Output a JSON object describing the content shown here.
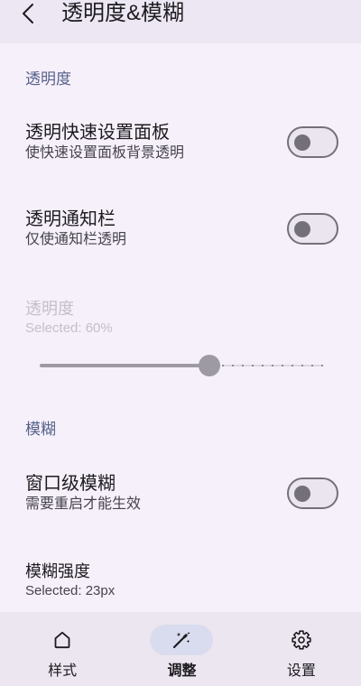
{
  "app_bar": {
    "back_icon": "chevron-left-icon",
    "title": "透明度&模糊"
  },
  "transparency_section": {
    "header": "透明度",
    "qs_panel": {
      "title": "透明快速设置面板",
      "summary": "使快速设置面板背景透明",
      "enabled": false
    },
    "notification_bar": {
      "title": "透明通知栏",
      "summary": "仅使通知栏透明",
      "enabled": false
    },
    "opacity": {
      "title": "透明度",
      "summary": "Selected: 60%",
      "value_percent": 60,
      "disabled": true
    }
  },
  "blur_section": {
    "header": "模糊",
    "window_blur": {
      "title": "窗口级模糊",
      "summary": "需要重启才能生效",
      "enabled": false
    },
    "blur_strength": {
      "title": "模糊强度",
      "summary": "Selected: 23px"
    }
  },
  "bottom_nav": {
    "items": [
      {
        "label": "样式",
        "icon": "home-icon",
        "active": false
      },
      {
        "label": "调整",
        "icon": "magic-wand-icon",
        "active": true
      },
      {
        "label": "设置",
        "icon": "gear-icon",
        "active": false
      }
    ]
  },
  "colors": {
    "background": "#f6f0fa",
    "app_bar": "#ede7f3",
    "nav_bar": "#ece6f0",
    "nav_indicator": "#d9dcee",
    "section_header": "#56628a",
    "text_primary": "#1c1b1f",
    "text_secondary": "#46444c",
    "text_disabled": "#c4bfc9",
    "switch_outline": "#74707a",
    "switch_track": "#ebe5ef",
    "slider_disabled": "#9e9aa4"
  }
}
